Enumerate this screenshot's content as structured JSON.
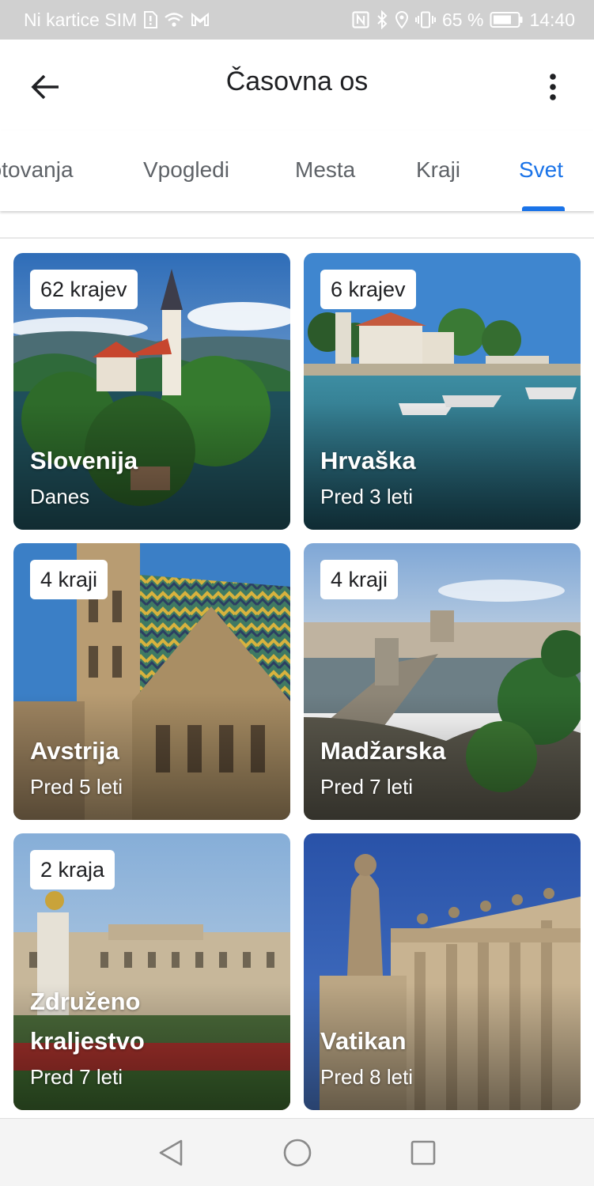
{
  "status_bar": {
    "carrier": "Ni kartice SIM",
    "battery": "65 %",
    "time": "14:40",
    "icons": [
      "sim-alert-icon",
      "wifi-icon",
      "gmail-icon",
      "nfc-icon",
      "bluetooth-icon",
      "location-icon",
      "vibrate-icon",
      "battery-icon"
    ]
  },
  "app_bar": {
    "title": "Časovna os",
    "back_icon": "arrow-back-icon",
    "menu_icon": "more-vert-icon"
  },
  "tabs": [
    {
      "label": "Potovanja",
      "active": false
    },
    {
      "label": "Vpogledi",
      "active": false
    },
    {
      "label": "Mesta",
      "active": false
    },
    {
      "label": "Kraji",
      "active": false
    },
    {
      "label": "Svet",
      "active": true
    }
  ],
  "colors": {
    "accent": "#1a73e8",
    "text_primary": "#202124",
    "text_secondary": "#5f6368"
  },
  "cards": [
    {
      "badge": "62 krajev",
      "name": "Slovenija",
      "subtitle": "Danes"
    },
    {
      "badge": "6 krajev",
      "name": "Hrvaška",
      "subtitle": "Pred 3 leti"
    },
    {
      "badge": "4 kraji",
      "name": "Avstrija",
      "subtitle": "Pred 5 leti"
    },
    {
      "badge": "4 kraji",
      "name": "Madžarska",
      "subtitle": "Pred 7 leti"
    },
    {
      "badge": "2 kraja",
      "name_line1": "Združeno",
      "name_line2": "kraljestvo",
      "subtitle": "Pred 7 leti"
    },
    {
      "badge": "",
      "name": "Vatikan",
      "subtitle": "Pred 8 leti"
    }
  ],
  "nav_bar": {
    "icons": [
      "nav-back-icon",
      "nav-home-icon",
      "nav-recents-icon"
    ]
  }
}
